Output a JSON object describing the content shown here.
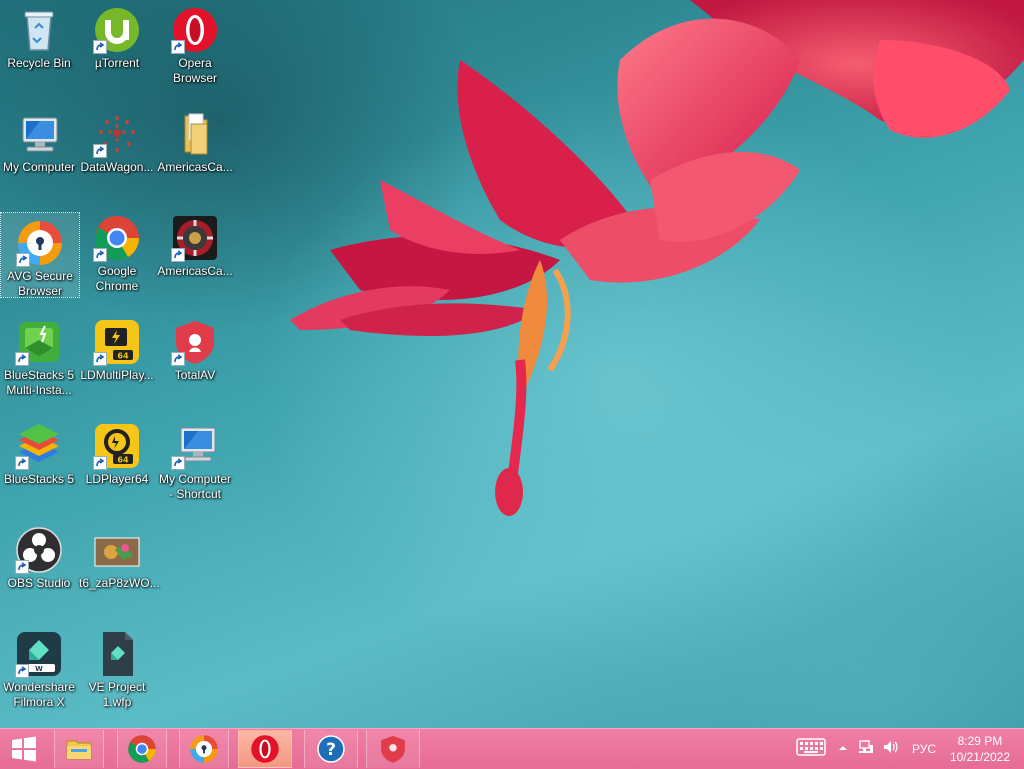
{
  "desktop": {
    "icons": [
      {
        "label": "Recycle Bin",
        "icon": "recycle-bin-icon"
      },
      {
        "label": "µTorrent",
        "icon": "utorrent-icon"
      },
      {
        "label": "Opera Browser",
        "icon": "opera-icon"
      },
      {
        "label": "My Computer",
        "icon": "computer-icon"
      },
      {
        "label": "DataWagon...",
        "icon": "datawagon-icon"
      },
      {
        "label": "AmericasCa...",
        "icon": "folder-icon"
      },
      {
        "label": "AVG Secure Browser",
        "icon": "avg-browser-icon"
      },
      {
        "label": "Google Chrome",
        "icon": "chrome-icon"
      },
      {
        "label": "AmericasCa...",
        "icon": "casino-chip-icon"
      },
      {
        "label": "BlueStacks 5 Multi-Insta...",
        "icon": "bluestacks-multi-icon"
      },
      {
        "label": "LDMultiPlay...",
        "icon": "ldmultiplayer-icon"
      },
      {
        "label": "TotalAV",
        "icon": "totalav-icon"
      },
      {
        "label": "BlueStacks 5",
        "icon": "bluestacks-icon"
      },
      {
        "label": "LDPlayer64",
        "icon": "ldplayer-icon"
      },
      {
        "label": "My Computer - Shortcut",
        "icon": "computer-icon"
      },
      {
        "label": "OBS Studio",
        "icon": "obs-icon"
      },
      {
        "label": "t6_zaP8zWO...",
        "icon": "image-thumbnail-icon"
      },
      {
        "label": "Wondershare Filmora X",
        "icon": "filmora-icon"
      },
      {
        "label": "VE Project 1.wfp",
        "icon": "filmora-project-icon"
      }
    ]
  },
  "taskbar": {
    "items": [
      {
        "icon": "windows-start-icon"
      },
      {
        "icon": "file-explorer-icon"
      },
      {
        "icon": "chrome-icon"
      },
      {
        "icon": "avg-browser-icon"
      },
      {
        "icon": "opera-icon"
      },
      {
        "icon": "help-icon"
      },
      {
        "icon": "totalav-icon"
      }
    ],
    "tray": {
      "language": "РУС",
      "time": "8:29 PM",
      "date": "10/21/2022"
    }
  },
  "colors": {
    "taskbar": "#e96f97",
    "desktop_teal": "#3ea3ad",
    "flower": "#e0284d"
  }
}
